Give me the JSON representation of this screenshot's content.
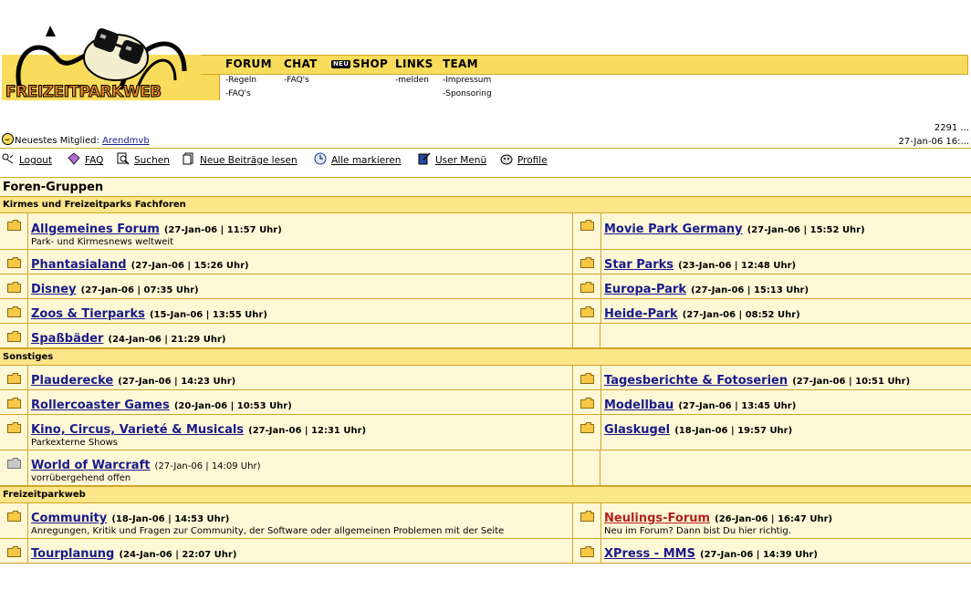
{
  "logo": {
    "text": "FREIZEITPARKWEB"
  },
  "nav": {
    "items": [
      {
        "label": "FORUM"
      },
      {
        "label": "CHAT"
      },
      {
        "badge": "NEU",
        "label": "SHOP"
      },
      {
        "label": "LINKS"
      },
      {
        "label": "TEAM"
      }
    ],
    "sub": {
      "forum_rules": "-Regeln",
      "forum_faq": "-FAQ's",
      "chat_faq": "-FAQ's",
      "links_report": "-melden",
      "team_imprint": "-Impressum",
      "team_sponsoring": "-Sponsoring"
    }
  },
  "stats": {
    "count": "2291 ...",
    "datetime": "27-Jan-06 16:..."
  },
  "newest_member": {
    "label": "Neuestes Mitglied:",
    "name": "Arendmvb"
  },
  "toolbar": {
    "logout": "Logout",
    "faq": "FAQ",
    "search": "Suchen",
    "new_posts": "Neue Beiträge lesen",
    "mark_all": "Alle markieren",
    "user_menu": "User Menü",
    "profile": "Profile"
  },
  "groups_title": "Foren-Gruppen",
  "categories": {
    "kirmes": "Kirmes und Freizeitparks Fachforen",
    "sonstiges": "Sonstiges",
    "fpw": "Freizeitparkweb"
  },
  "forums": {
    "allgemeines": {
      "name": "Allgemeines Forum",
      "date": "(27-Jan-06 | 11:57 Uhr)",
      "desc": "Park- und Kirmesnews weltweit"
    },
    "moviepark": {
      "name": "Movie Park Germany",
      "date": "(27-Jan-06 | 15:52 Uhr)"
    },
    "phantasialand": {
      "name": "Phantasialand",
      "date": "(27-Jan-06 | 15:26 Uhr)"
    },
    "starparks": {
      "name": "Star Parks",
      "date": "(23-Jan-06 | 12:48 Uhr)"
    },
    "disney": {
      "name": "Disney",
      "date": "(27-Jan-06 | 07:35 Uhr)"
    },
    "europapark": {
      "name": "Europa-Park",
      "date": "(27-Jan-06 | 15:13 Uhr)"
    },
    "zoos": {
      "name": "Zoos & Tierparks",
      "date": "(15-Jan-06 | 13:55 Uhr)"
    },
    "heidepark": {
      "name": "Heide-Park",
      "date": "(27-Jan-06 | 08:52 Uhr)"
    },
    "spassbaeder": {
      "name": "Spaßbäder",
      "date": "(24-Jan-06 | 21:29 Uhr)"
    },
    "plauderecke": {
      "name": "Plauderecke",
      "date": "(27-Jan-06 | 14:23 Uhr)"
    },
    "tagesberichte": {
      "name": "Tagesberichte & Fotoserien",
      "date": "(27-Jan-06 | 10:51 Uhr)"
    },
    "rollercoaster": {
      "name": "Rollercoaster Games",
      "date": "(20-Jan-06 | 10:53 Uhr)"
    },
    "modellbau": {
      "name": "Modellbau",
      "date": "(27-Jan-06 | 13:45 Uhr)"
    },
    "kino": {
      "name": "Kino, Circus, Varieté & Musicals",
      "date": "(27-Jan-06 | 12:31 Uhr)",
      "desc": "Parkexterne Shows"
    },
    "glaskugel": {
      "name": "Glaskugel",
      "date": "(18-Jan-06 | 19:57 Uhr)"
    },
    "wow": {
      "name": "World of Warcraft",
      "date": "(27-Jan-06 | 14:09 Uhr)",
      "desc": "vorrübergehend offen"
    },
    "community": {
      "name": "Community",
      "date": "(18-Jan-06 | 14:53 Uhr)",
      "desc": "Anregungen, Kritik und Fragen zur Community, der Software oder allgemeinen Problemen mit der Seite"
    },
    "neulings": {
      "name": "Neulings-Forum",
      "date": "(26-Jan-06 | 16:47 Uhr)",
      "desc": "Neu im Forum? Dann bist Du hier richtig."
    },
    "tourplanung": {
      "name": "Tourplanung",
      "date": "(24-Jan-06 | 22:07 Uhr)"
    },
    "xpress": {
      "name": "XPress - MMS",
      "date": "(27-Jan-06 | 14:39 Uhr)"
    }
  },
  "colors": {
    "accent_yellow": "#f9dc5c",
    "row_bg": "#fff8d6",
    "cat_bg": "#fde58a",
    "border": "#d1a528",
    "link": "#1a1a8c",
    "link_red": "#b32020"
  }
}
